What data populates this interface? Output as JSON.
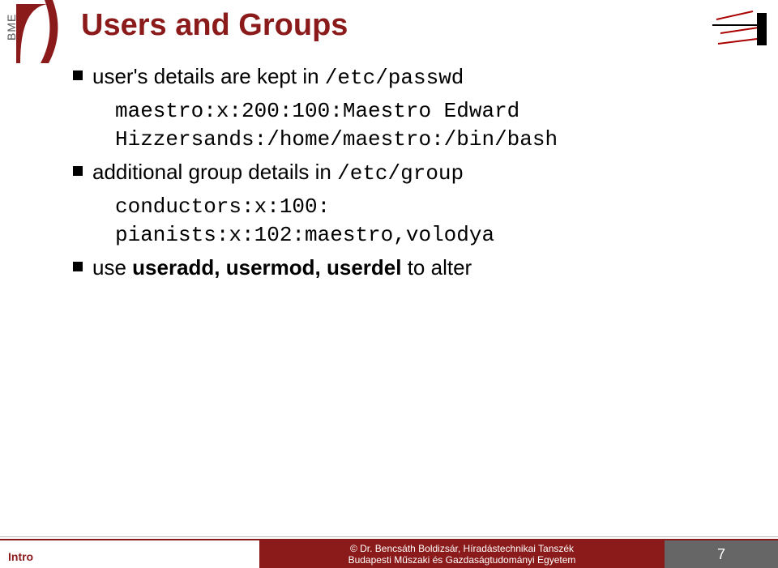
{
  "logo": {
    "bme_text": "BME"
  },
  "title": "Users and Groups",
  "bullets": [
    {
      "text_prefix": "user's details are kept in ",
      "text_mono": "/etc/passwd",
      "sub": [
        "maestro:x:200:100:Maestro Edward",
        "Hizzersands:/home/maestro:/bin/bash"
      ]
    },
    {
      "text_prefix": "additional group details in ",
      "text_mono": "/etc/group",
      "sub": [
        "conductors:x:100:",
        "pianists:x:102:maestro,volodya"
      ]
    },
    {
      "text_prefix": "use ",
      "text_bold": "useradd, usermod, userdel",
      "text_suffix": " to alter"
    }
  ],
  "footer": {
    "left": "Intro",
    "mid_line1": "© Dr. Bencsáth Boldizsár, Híradástechnikai Tanszék",
    "mid_line2": "Budapesti Műszaki és Gazdaságtudományi Egyetem",
    "page": "7"
  }
}
